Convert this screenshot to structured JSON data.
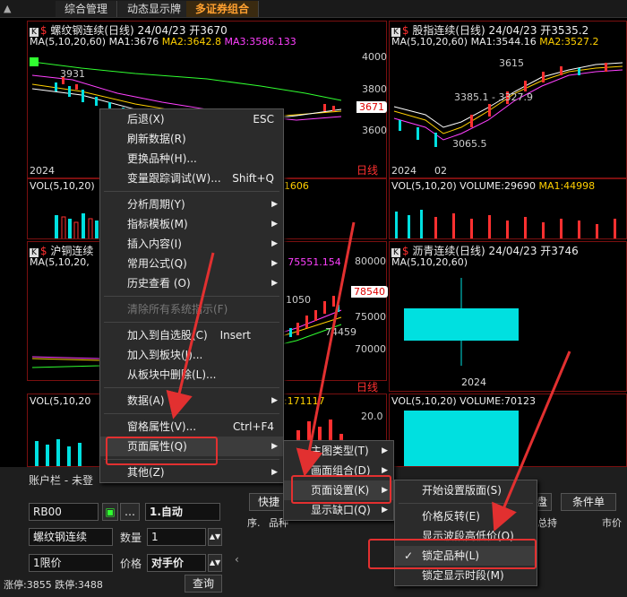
{
  "tabs": {
    "home": "▲",
    "items": [
      "综合管理",
      "动态显示牌",
      "多证券组合"
    ]
  },
  "panes": {
    "p1": {
      "badge": "K",
      "sym": "$",
      "title": "螺纹钢连续(日线) 24/04/23 开3670",
      "ma_prefix": "MA(5,10,20,60)",
      "ma1": "MA1:3676",
      "ma2": "MA2:3642.8",
      "ma3": "MA3:3586.133",
      "low_label": "3931",
      "price_tag": "3671",
      "year": "2024",
      "vol_title": "VOL(5,10,20)",
      "vol_ma2": "MA2:1606",
      "scale": [
        "4000",
        "3800",
        "3600"
      ],
      "xaxis": "日线"
    },
    "p2": {
      "badge": "K",
      "sym": "$",
      "title": "股指连续(日线) 24/04/23 开3535.2",
      "ma_prefix": "MA(5,10,20,60)",
      "ma1": "MA1:3544.16",
      "ma2": "MA2:3527.2",
      "hi_label": "3615",
      "mid_label": "3385.1 - 3327.9",
      "low_label": "3065.5",
      "year": "2024",
      "month": "02",
      "vol_title": "VOL(5,10,20) VOLUME:29690",
      "vol_ma1": "MA1:44998"
    },
    "p3": {
      "badge": "K",
      "sym": "$",
      "title": "沪铜连续",
      "ma_prefix": "MA(5,10,20,",
      "ma3": "75551.154",
      "l1": "1050",
      "l2": "74459",
      "price_tag": "78540",
      "scale": [
        "80000",
        "75000",
        "70000"
      ],
      "xaxis": "日线",
      "vol_title": "VOL(5,10,20",
      "vol_ma2": "MA2:171117",
      "vol_scale": "20.0"
    },
    "p4": {
      "badge": "K",
      "sym": "$",
      "title": "沥青连续(日线) 24/04/23 开3746",
      "ma_prefix": "MA(5,10,20,60)",
      "year": "2024",
      "vol_title": "VOL(5,10,20) VOLUME:70123"
    }
  },
  "menu1": {
    "items": [
      {
        "label": "后退(X)",
        "shortcut": "ESC"
      },
      {
        "label": "刷新数据(R)"
      },
      {
        "label": "更换品种(H)..."
      },
      {
        "label": "变量跟踪调试(W)...",
        "shortcut": "Shift+Q"
      },
      {
        "label": "分析周期(Y)"
      },
      {
        "label": "指标模板(M)"
      },
      {
        "label": "插入内容(I)"
      },
      {
        "label": "常用公式(Q)"
      },
      {
        "label": "历史查看 (O)"
      },
      {
        "label": "清除所有系统指示(F)"
      },
      {
        "label": "加入到自选股(C)",
        "shortcut": "Insert"
      },
      {
        "label": "加入到板块(J)..."
      },
      {
        "label": "从板块中删除(L)..."
      },
      {
        "label": "数据(A)"
      },
      {
        "label": "窗格属性(V)...",
        "shortcut": "Ctrl+F4"
      },
      {
        "label": "页面属性(Q)"
      },
      {
        "label": "其他(Z)"
      }
    ]
  },
  "menu2": {
    "items": [
      {
        "label": "主图类型(T)"
      },
      {
        "label": "画面组合(D)"
      },
      {
        "label": "页面设置(K)"
      },
      {
        "label": "显示缺口(Q)"
      }
    ]
  },
  "menu3": {
    "items": [
      {
        "label": "开始设置版面(S)"
      },
      {
        "label": "价格反转(E)"
      },
      {
        "label": "显示波段高低价(O)"
      },
      {
        "label": "锁定品种(L)",
        "check": "✓"
      },
      {
        "label": "锁定显示时段(M)"
      }
    ]
  },
  "account": {
    "title": "账户栏 - 未登",
    "code": "RB00",
    "auto": "1.自动",
    "name": "螺纹钢连续",
    "qty_label": "数量",
    "qty": "1",
    "order_type": "1限价",
    "price_label": "价格",
    "price": "对手价",
    "limits": "涨停:3855 跌停:3488",
    "query": "查询",
    "quick": "快捷",
    "cond": "条件单",
    "col_seq": "序.",
    "col_pin": "品种",
    "col_hold": "总持",
    "col_market": "市价",
    "pan": "盘"
  },
  "colors": {
    "accent_red": "#e23030",
    "up": "#ff3030",
    "down": "#00e0e0"
  }
}
